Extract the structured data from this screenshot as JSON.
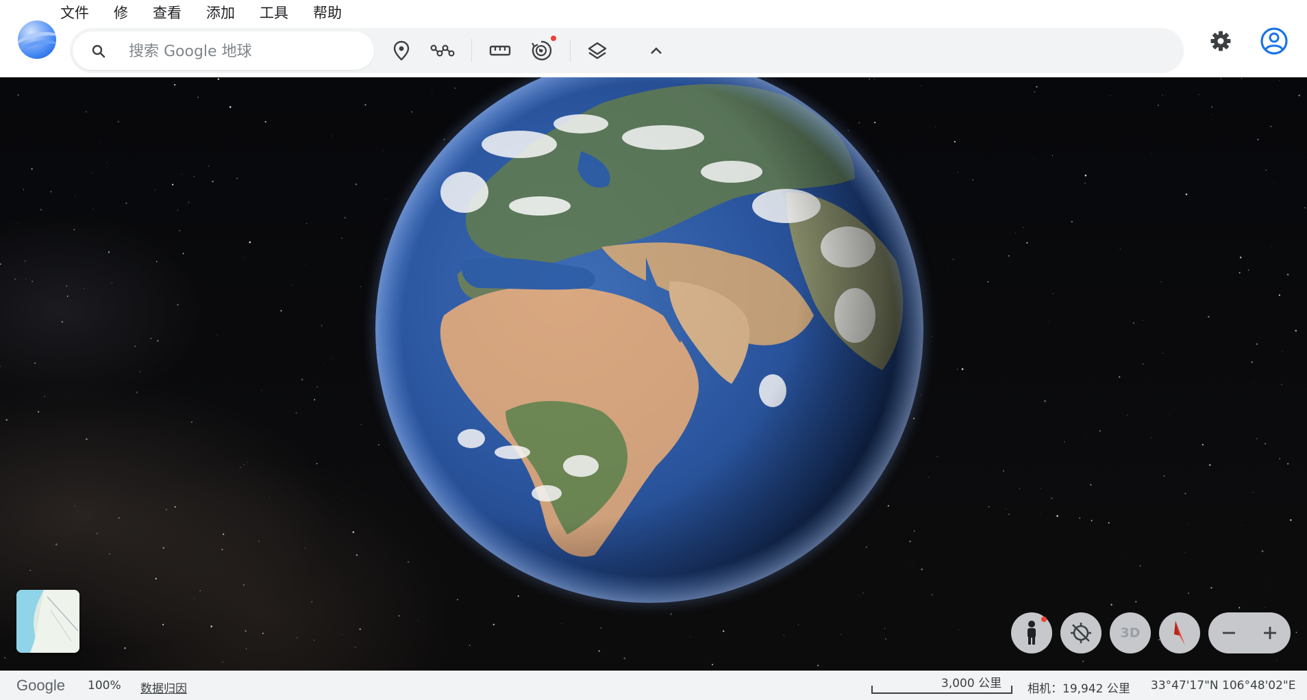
{
  "menu": {
    "items": [
      "文件",
      "修",
      "查看",
      "添加",
      "工具",
      "帮助"
    ]
  },
  "search": {
    "placeholder": "搜索 Google 地球"
  },
  "toolbar": {
    "icons": [
      "place-marker",
      "path",
      "ruler",
      "voyager",
      "layers",
      "chevron-up"
    ]
  },
  "controls": {
    "btn_3d": "3D"
  },
  "status": {
    "brand": "Google",
    "zoom": "100%",
    "attribution": "数据归因",
    "scale": "3,000 公里",
    "camera": "相机：19,942 公里",
    "coordinates": "33°47'17\"N 106°48'02\"E"
  },
  "colors": {
    "accent": "#1a73e8",
    "notification": "#ea4335",
    "toolbar_bg": "#f1f3f4"
  }
}
